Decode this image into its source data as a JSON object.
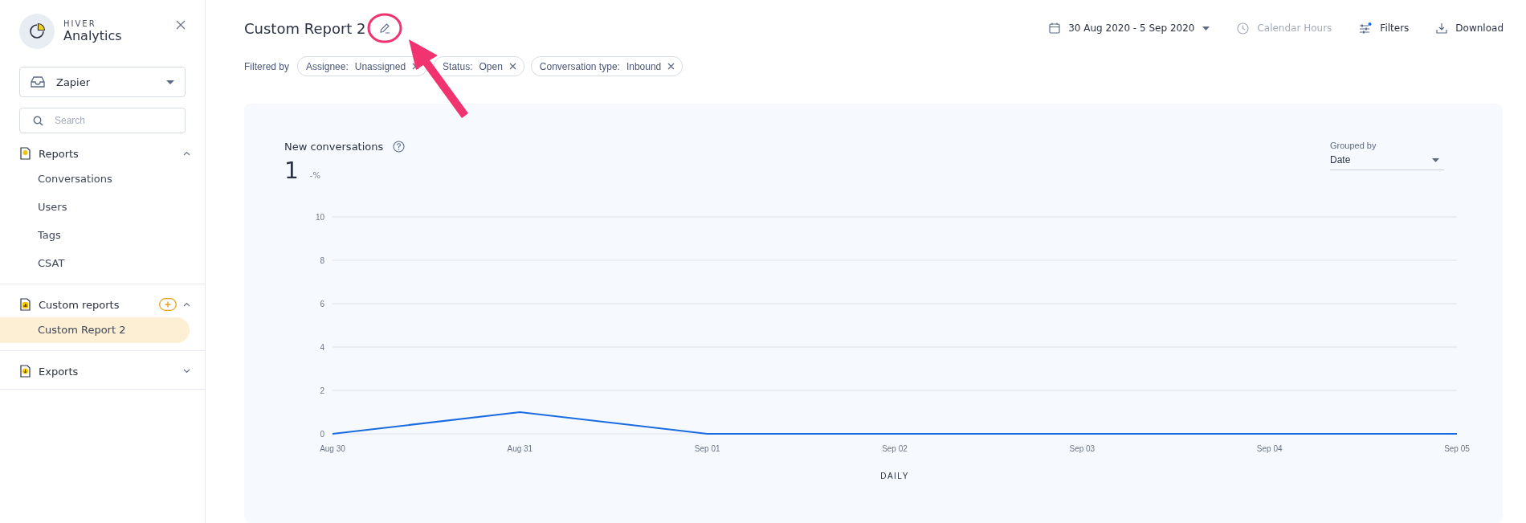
{
  "sidebar": {
    "brand": {
      "overline": "HIVER",
      "name": "Analytics"
    },
    "inbox": {
      "value": "Zapier"
    },
    "search": {
      "placeholder": "Search"
    },
    "sections": [
      {
        "kind": "reports",
        "label": "Reports",
        "expanded": true,
        "has_add": false,
        "items": [
          {
            "label": "Conversations",
            "selected": false
          },
          {
            "label": "Users",
            "selected": false
          },
          {
            "label": "Tags",
            "selected": false
          },
          {
            "label": "CSAT",
            "selected": false
          }
        ]
      },
      {
        "kind": "custom",
        "label": "Custom reports",
        "expanded": true,
        "has_add": true,
        "items": [
          {
            "label": "Custom Report 2",
            "selected": true
          }
        ]
      },
      {
        "kind": "exports",
        "label": "Exports",
        "expanded": false,
        "has_add": false
      }
    ]
  },
  "header": {
    "title": "Custom Report 2",
    "date_range": "30 Aug 2020 - 5 Sep 2020",
    "actions": [
      {
        "kind": "hours",
        "label": "Calendar Hours",
        "disabled": true
      },
      {
        "kind": "filters",
        "label": "Filters",
        "disabled": false
      },
      {
        "kind": "download",
        "label": "Download",
        "disabled": false
      }
    ]
  },
  "filters": {
    "label": "Filtered by",
    "chips": [
      {
        "key": "Assignee:",
        "value": "Unassigned"
      },
      {
        "key": "Status:",
        "value": "Open"
      },
      {
        "key": "Conversation type:",
        "value": "Inbound"
      }
    ]
  },
  "card": {
    "title": "New conversations",
    "value": "1",
    "change": "-%",
    "grouped_by": {
      "label": "Grouped by",
      "value": "Date"
    },
    "chart_data": {
      "type": "line",
      "xlabel": "DAILY",
      "categories": [
        "Aug 30",
        "Aug 31",
        "Sep 01",
        "Sep 02",
        "Sep 03",
        "Sep 04",
        "Sep 05"
      ],
      "series": [
        {
          "color": "#1a6be0",
          "values": [
            0,
            1,
            0,
            0,
            0,
            0,
            0
          ]
        }
      ],
      "ylim": [
        0,
        10
      ],
      "yticks": [
        0,
        2,
        4,
        6,
        8,
        10
      ],
      "grid": true
    }
  }
}
